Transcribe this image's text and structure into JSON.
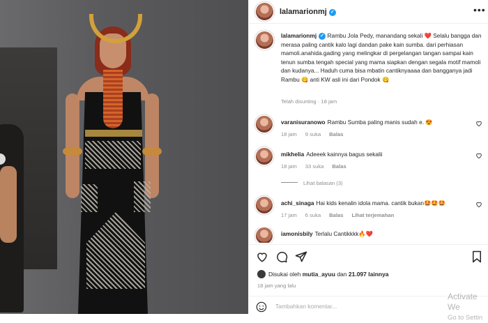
{
  "post": {
    "username": "lalamarionmj",
    "caption_text": "Rambu Jola Pedy, manandang sekali ❤️ Selalu bangga dan merasa paling cantik kalo lagi dandan pake kain sumba. dari perhiasan mamoli.anahida.gading yang melingkar di pergelangan tangan sampai kain tenun sumba tengah special yang mama siapkan dengan segala motif mamoli dan kudanya... Haduh cuma bisa mbatin cantiknyaaaa dan bangganya jadi Rambu 😋 anti KW asli ini dari Pondok 😋",
    "edited_label": "Telah disunting",
    "edited_time": "18 jam"
  },
  "comments": [
    {
      "user": "varanisuranowo",
      "text": "Rambu Sumba paling manis sudah e. 😍",
      "time": "18 jam",
      "likes": "9 suka",
      "reply": "Balas",
      "translate": ""
    },
    {
      "user": "mikhelia",
      "text": "Adeeek kainnya bagus sekalii",
      "time": "18 jam",
      "likes": "33 suka",
      "reply": "Balas",
      "translate": ""
    },
    {
      "user": "achi_sinaga",
      "text": "Hai kids kenalin idola mama. cantik bukan🤩🤩🤩",
      "time": "17 jam",
      "likes": "6 suka",
      "reply": "Balas",
      "translate": "Lihat terjemahan"
    },
    {
      "user": "iamonisbily",
      "text": "Terlalu Cantikkkk🔥❤️",
      "time": "",
      "likes": "",
      "reply": "",
      "translate": ""
    }
  ],
  "view_replies": "Lihat balasan (3)",
  "likes": {
    "prefix": "Disukai oleh",
    "user": "mutia_ayuu",
    "middle": "dan",
    "count": "21.097",
    "suffix": "lainnya"
  },
  "post_time": "18 jam yang lalu",
  "add_comment": {
    "placeholder": "Tambahkan komentar..."
  },
  "watermark": {
    "line1": "Activate We",
    "line2": "Go to Settin"
  },
  "icons": {
    "more": "more-options-icon",
    "heart": "heart-icon",
    "comment": "comment-icon",
    "share": "share-icon",
    "save": "bookmark-icon",
    "emoji": "emoji-icon"
  }
}
